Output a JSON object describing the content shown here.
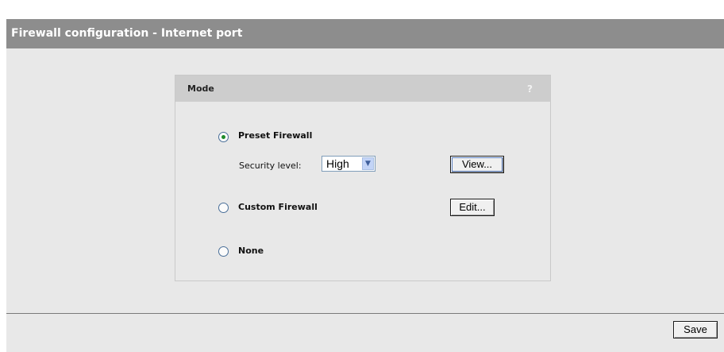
{
  "header": {
    "title": "Firewall configuration - Internet port"
  },
  "mode_panel": {
    "title": "Mode",
    "help_icon": "?",
    "options": [
      {
        "label": "Preset Firewall",
        "selected": true
      },
      {
        "label": "Custom Firewall",
        "selected": false
      },
      {
        "label": "None",
        "selected": false
      }
    ],
    "security_level": {
      "label": "Security level:",
      "value": "High"
    },
    "view_button": "View...",
    "edit_button": "Edit..."
  },
  "footer": {
    "save_button": "Save"
  },
  "icons": {
    "help": "help-icon",
    "dropdown": "chevron-down-icon"
  },
  "colors": {
    "title_bar": "#8d8d8d",
    "panel_header": "#cdcdcd",
    "background": "#e8e8e8",
    "radio_dot": "#1e8a2a"
  }
}
